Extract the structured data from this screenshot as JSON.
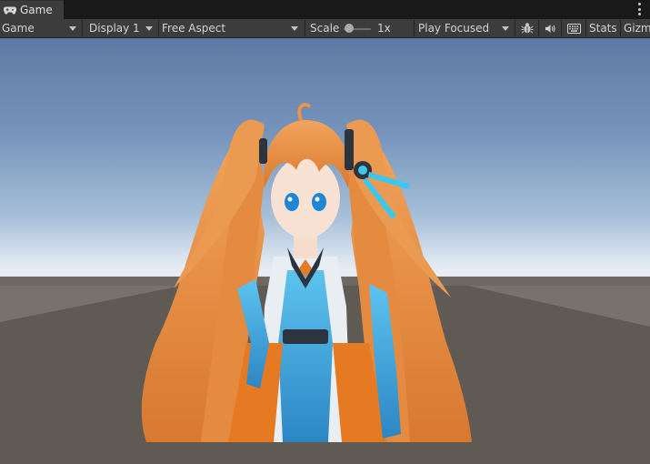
{
  "tab": {
    "title": "Game",
    "icon": "gamepad-icon"
  },
  "toolbar": {
    "view_mode": "Game",
    "display": "Display 1",
    "aspect": "Free Aspect",
    "scale_label": "Scale",
    "scale_value": "1x",
    "scale_fraction": 0,
    "play_mode": "Play Focused",
    "bug_icon": "bug-icon",
    "audio_icon": "speaker-icon",
    "keyboard_icon": "keyboard-icon",
    "stats_label": "Stats",
    "gizmos_label": "Gizm"
  },
  "colors": {
    "panel": "#3c3c3c",
    "background": "#191919",
    "hair": "#e8944a",
    "suit_blue": "#3fa4dc",
    "suit_orange": "#e67a22"
  }
}
